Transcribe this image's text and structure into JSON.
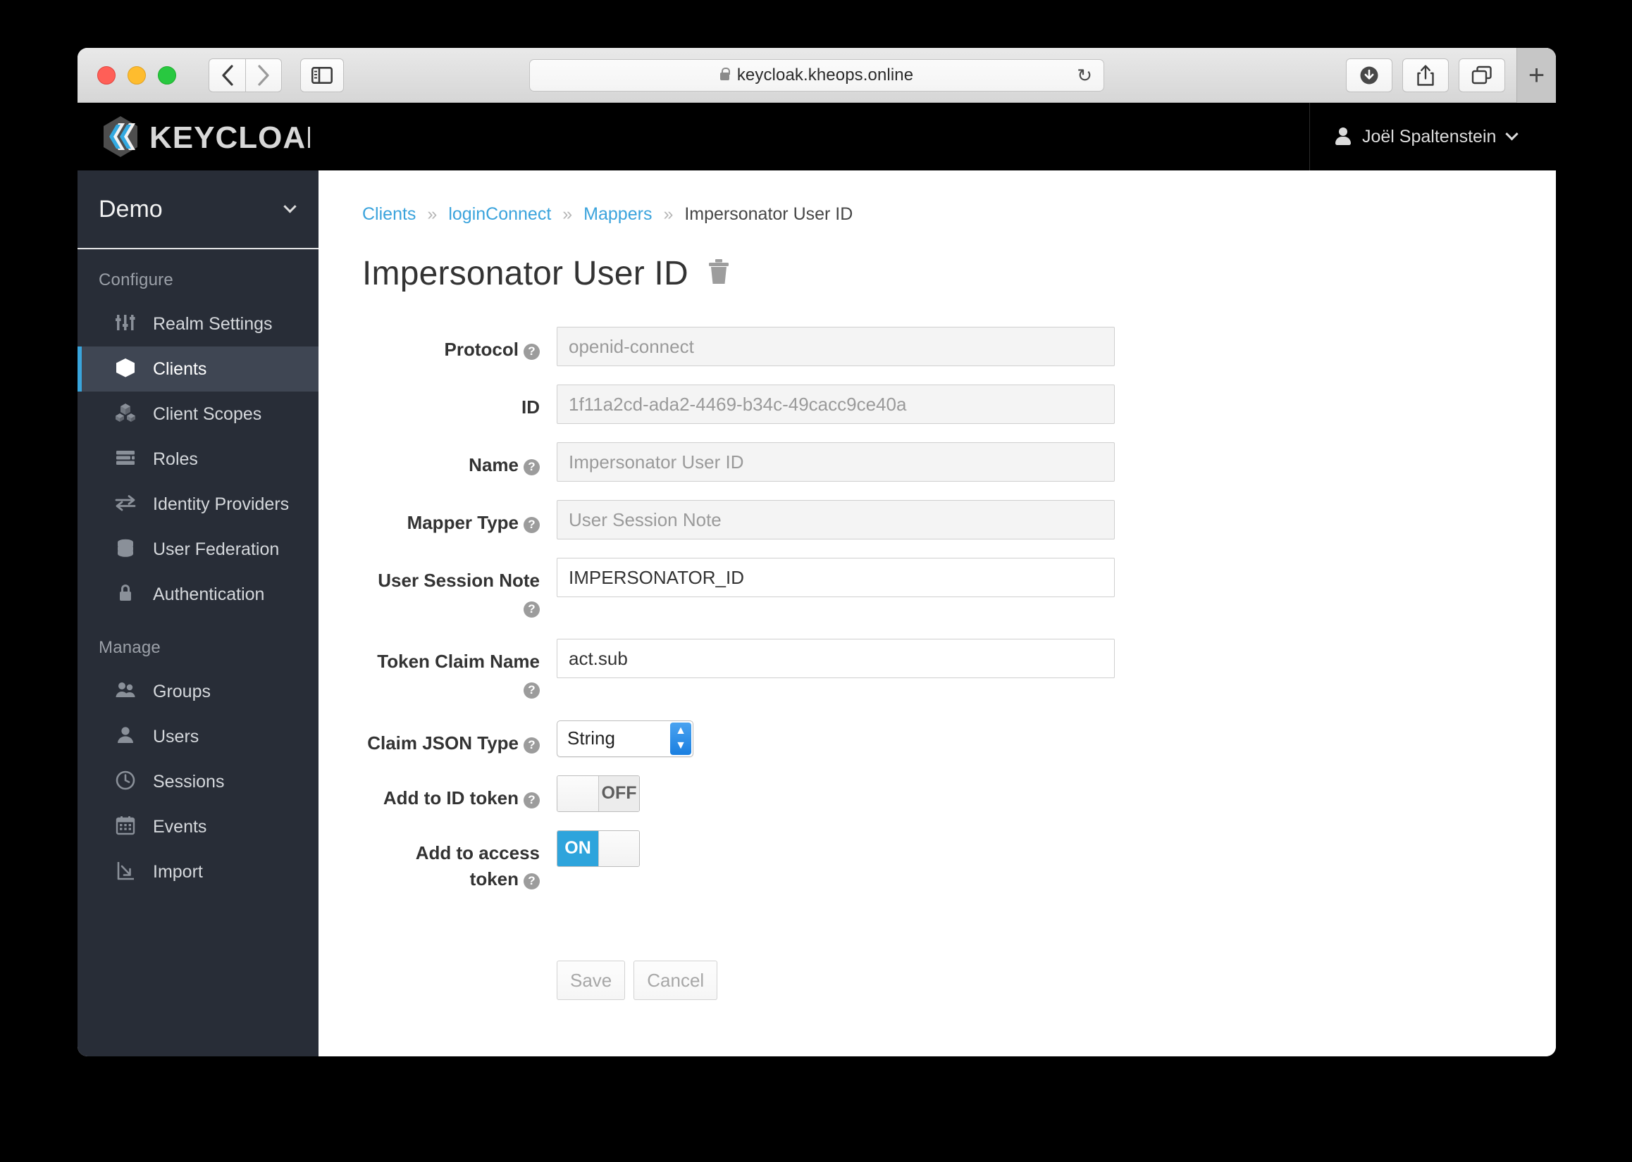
{
  "browser": {
    "url": "keycloak.kheops.online",
    "lock_icon": "lock-icon",
    "reload_icon": "↻",
    "back_icon": "‹",
    "forward_icon": "›",
    "sidebar_icon": "sidebar-icon",
    "downloads_icon": "download-icon",
    "share_icon": "share-icon",
    "tabs_icon": "tab-overview-icon",
    "newtab_icon": "+"
  },
  "header": {
    "brand": "KEYCLOAK",
    "user_name": "Joël Spaltenstein",
    "user_icon": "person-icon",
    "chevron_icon": "chevron-down-icon"
  },
  "sidebar": {
    "realm": "Demo",
    "realm_chevron": "chevron-down-icon",
    "sections": [
      {
        "title": "Configure",
        "items": [
          {
            "label": "Realm Settings",
            "icon": "sliders-icon",
            "active": false
          },
          {
            "label": "Clients",
            "icon": "cube-icon",
            "active": true
          },
          {
            "label": "Client Scopes",
            "icon": "cubes-icon",
            "active": false
          },
          {
            "label": "Roles",
            "icon": "list-icon",
            "active": false
          },
          {
            "label": "Identity Providers",
            "icon": "exchange-icon",
            "active": false
          },
          {
            "label": "User Federation",
            "icon": "database-icon",
            "active": false
          },
          {
            "label": "Authentication",
            "icon": "lock-icon",
            "active": false
          }
        ]
      },
      {
        "title": "Manage",
        "items": [
          {
            "label": "Groups",
            "icon": "users-icon",
            "active": false
          },
          {
            "label": "Users",
            "icon": "user-icon",
            "active": false
          },
          {
            "label": "Sessions",
            "icon": "clock-icon",
            "active": false
          },
          {
            "label": "Events",
            "icon": "calendar-icon",
            "active": false
          },
          {
            "label": "Import",
            "icon": "import-icon",
            "active": false
          }
        ]
      }
    ]
  },
  "breadcrumb": {
    "items": [
      "Clients",
      "loginConnect",
      "Mappers",
      "Impersonator User ID"
    ],
    "separator": "»"
  },
  "page": {
    "title": "Impersonator User ID",
    "delete_icon": "trash-icon"
  },
  "form": {
    "help_glyph": "?",
    "fields": [
      {
        "label": "Protocol",
        "help": true,
        "value": "openid-connect",
        "type": "text",
        "disabled": true
      },
      {
        "label": "ID",
        "help": false,
        "value": "1f11a2cd-ada2-4469-b34c-49cacc9ce40a",
        "type": "text",
        "disabled": true
      },
      {
        "label": "Name",
        "help": true,
        "value": "Impersonator User ID",
        "type": "text",
        "disabled": true
      },
      {
        "label": "Mapper Type",
        "help": true,
        "value": "User Session Note",
        "type": "text",
        "disabled": true
      },
      {
        "label": "User Session Note",
        "help": true,
        "value": "IMPERSONATOR_ID",
        "type": "text",
        "disabled": false
      },
      {
        "label": "Token Claim Name",
        "help": true,
        "value": "act.sub",
        "type": "text",
        "disabled": false
      },
      {
        "label": "Claim JSON Type",
        "help": true,
        "value": "String",
        "type": "select",
        "disabled": false
      },
      {
        "label": "Add to ID token",
        "help": true,
        "value": "OFF",
        "type": "toggle",
        "state": "off"
      },
      {
        "label": "Add to access token",
        "help": true,
        "value": "ON",
        "type": "toggle",
        "state": "on"
      }
    ],
    "save_label": "Save",
    "cancel_label": "Cancel"
  },
  "colors": {
    "accent_blue": "#39a5dc",
    "link_blue": "#3aa3dc",
    "sidebar_bg": "#282d37",
    "sidebar_active_bg": "#3f4653",
    "header_bg": "#000000",
    "toggle_on": "#2ea4dc"
  }
}
